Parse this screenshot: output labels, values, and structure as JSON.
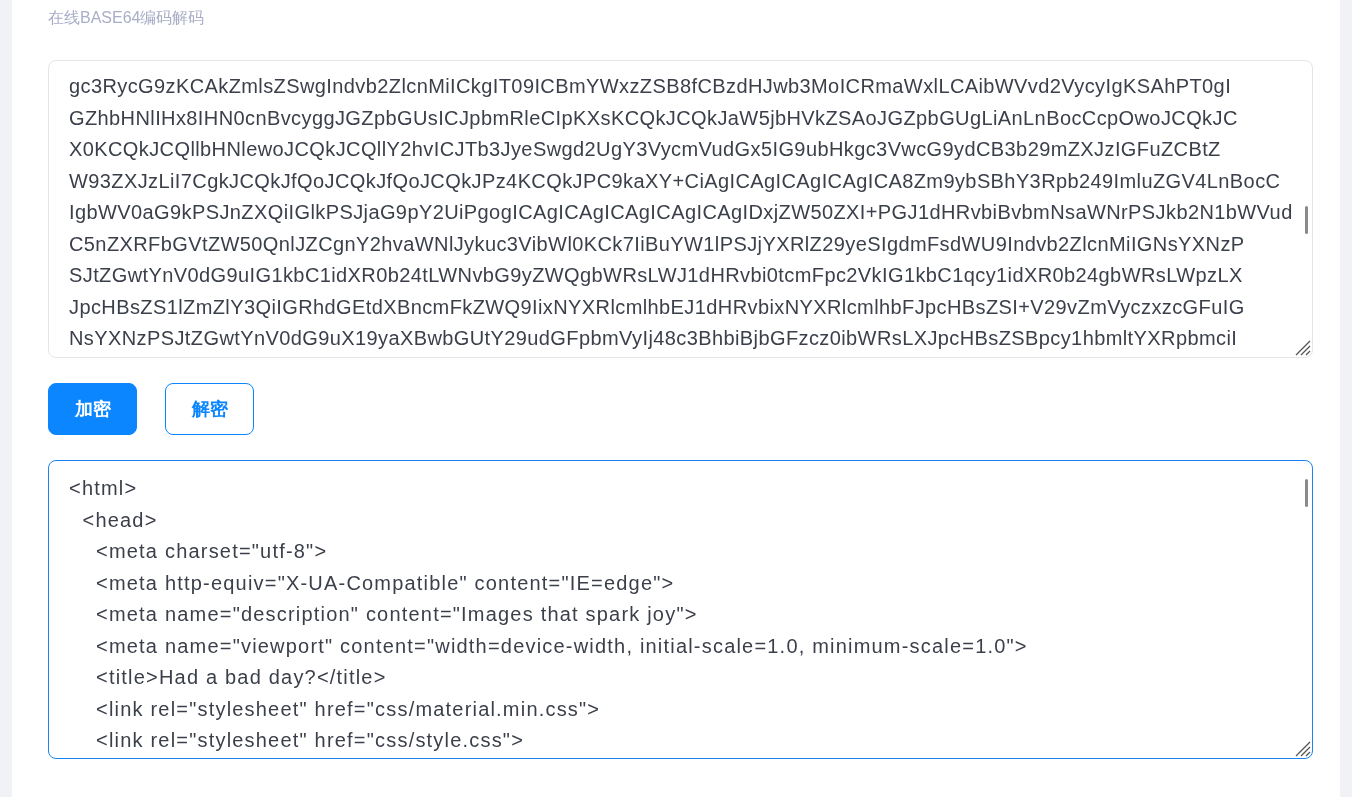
{
  "page_title": "在线BASE64编码解码",
  "encoded_field": {
    "focused": false,
    "lines": [
      "gc3RycG9zKCAkZmlsZSwgIndvb2ZlcnMiICkgIT09ICBmYWxzZSB8fCBzdHJwb3MoICRmaWxlLCAibWVvd2VycyIgKSAhPT0gI",
      "GZhbHNlIHx8IHN0cnBvcyggJGZpbGUsICJpbmRleCIpKXsKCQkJCQkJaW5jbHVkZSAoJGZpbGUgLiAnLnBocCcpOwoJCQkJC",
      "X0KCQkJCQllbHNlewoJCQkJCQllY2hvICJTb3JyeSwgd2UgY3VycmVudGx5IG9ubHkgc3VwcG9ydCB3b29mZXJzIGFuZCBtZ",
      "W93ZXJzLiI7CgkJCQkJfQoJCQkJfQoJCQkJPz4KCQkJPC9kaXY+CiAgICAgICAgICAgICA8Zm9ybSBhY3Rpb249ImluZGV4LnBocC",
      "IgbWV0aG9kPSJnZXQiIGlkPSJjaG9pY2UiPgogICAgICAgICAgICAgICAgIDxjZW50ZXI+PGJ1dHRvbiBvbmNsaWNrPSJkb2N1bWVud",
      "C5nZXRFbGVtZW50QnlJZCgnY2hvaWNlJykuc3VibWl0KCk7IiBuYW1lPSJjYXRlZ29yeSIgdmFsdWU9Indvb2ZlcnMiIGNsYXNzP",
      "SJtZGwtYnV0dG9uIG1kbC1idXR0b24tLWNvbG9yZWQgbWRsLWJ1dHRvbi0tcmFpc2VkIG1kbC1qcy1idXR0b24gbWRsLWpzLX",
      "JpcHBsZS1lZmZlY3QiIGRhdGEtdXBncmFkZWQ9IixNYXRlcmlhbEJ1dHRvbixNYXRlcmlhbFJpcHBsZSI+V29vZmVyczxzcGFuIG",
      "NsYXNzPSJtZGwtYnV0dG9uX19yaXBwbGUtY29udGFpbmVyIj48c3BhbiBjbGFzcz0ibWRsLXJpcHBsZSBpcy1hbmltYXRpbmciI"
    ]
  },
  "buttons": [
    {
      "label": "加密",
      "kind": "primary"
    },
    {
      "label": "解密",
      "kind": "outline"
    }
  ],
  "decoded_field": {
    "focused": true,
    "lines": [
      "<html>",
      "  <head>",
      "    <meta charset=\"utf-8\">",
      "    <meta http-equiv=\"X-UA-Compatible\" content=\"IE=edge\">",
      "    <meta name=\"description\" content=\"Images that spark joy\">",
      "    <meta name=\"viewport\" content=\"width=device-width, initial-scale=1.0, minimum-scale=1.0\">",
      "    <title>Had a bad day?</title>",
      "    <link rel=\"stylesheet\" href=\"css/material.min.css\">",
      "    <link rel=\"stylesheet\" href=\"css/style.css\">"
    ]
  }
}
